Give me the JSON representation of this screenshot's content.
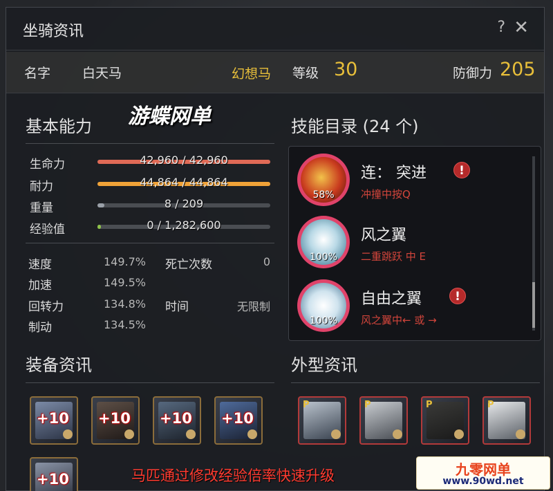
{
  "window": {
    "title": "坐骑资讯"
  },
  "titlebar": {
    "help_label": "?",
    "close_label": "✕"
  },
  "info": {
    "name_label": "名字",
    "name_value": "白天马",
    "type": "幻想马",
    "level_label": "等级",
    "level_value": "30",
    "defense_label": "防御力",
    "defense_value": "205"
  },
  "watermark": "游蝶网单",
  "basic": {
    "title": "基本能力",
    "stats": [
      {
        "name": "生命力",
        "value": "42,960 / 42,960",
        "fill": 1.0,
        "color": "#e06a56"
      },
      {
        "name": "耐力",
        "value": "44,864 / 44,864",
        "fill": 1.0,
        "color": "#f0a238"
      },
      {
        "name": "重量",
        "value": "8 / 209",
        "fill": 0.038,
        "color": "#9aa0a8"
      },
      {
        "name": "经验值",
        "value": "0 / 1,282,600",
        "fill": 0.02,
        "color": "#8ec24a"
      }
    ],
    "attrs": [
      {
        "name": "速度",
        "value": "149.7%"
      },
      {
        "name": "加速",
        "value": "149.5%"
      },
      {
        "name": "回转力",
        "value": "134.8%"
      },
      {
        "name": "制动",
        "value": "134.5%"
      }
    ],
    "death_label": "死亡次数",
    "death_value": "0",
    "time_label": "时间",
    "time_value": "无限制"
  },
  "skills": {
    "title": "技能目录 (24 个)",
    "items": [
      {
        "name": "连： 突进",
        "desc": "冲撞中按Q",
        "pct": "58%",
        "warning": true,
        "icon": "horse-charge-icon"
      },
      {
        "name": "风之翼",
        "desc": "二重跳跃 中 E",
        "pct": "100%",
        "warning": false,
        "icon": "pegasus-wing-icon"
      },
      {
        "name": "自由之翼",
        "desc": "风之翼中← 或 →",
        "pct": "100%",
        "warning": true,
        "icon": "pegasus-flight-icon"
      }
    ]
  },
  "equipment": {
    "title": "装备资讯",
    "items": [
      {
        "label": "+10",
        "icon": "horse-armor-icon"
      },
      {
        "label": "+10",
        "icon": "saddle-icon"
      },
      {
        "label": "+10",
        "icon": "stirrup-icon"
      },
      {
        "label": "+10",
        "icon": "horseshoe-icon"
      },
      {
        "label": "+10",
        "icon": "horse-shoe-ring-icon"
      }
    ]
  },
  "appearance": {
    "title": "外型资讯",
    "items": [
      {
        "badge": "P",
        "icon": "barding-icon"
      },
      {
        "badge": "P",
        "icon": "saddle-armor-icon"
      },
      {
        "badge": "P",
        "icon": "stirrup-gold-icon"
      },
      {
        "badge": "P",
        "icon": "horse-mask-icon"
      }
    ]
  },
  "footer_caption": "马匹通过修改经验倍率快速升级",
  "site_badge": {
    "name": "九零网单",
    "url": "www.90wd.net"
  },
  "colors": {
    "gold": "#e8bf3a",
    "skill_ring": "#e0436a",
    "warning": "#b52a2a",
    "desc_red": "#d2453b"
  }
}
